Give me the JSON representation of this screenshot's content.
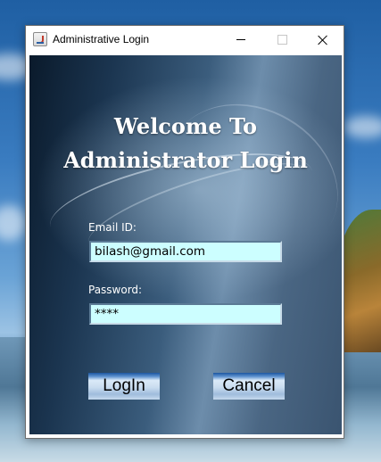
{
  "window": {
    "title": "Administrative Login"
  },
  "header": {
    "line1": "Welcome To",
    "line2": "Administrator Login"
  },
  "form": {
    "email_label": "Email ID:",
    "email_value": "bilash@gmail.com",
    "password_label": "Password:",
    "password_value": "****"
  },
  "buttons": {
    "login_label": "LogIn",
    "cancel_label": "Cancel"
  },
  "colors": {
    "field_background": "#ccfeff",
    "heading_text": "#ffffff"
  }
}
